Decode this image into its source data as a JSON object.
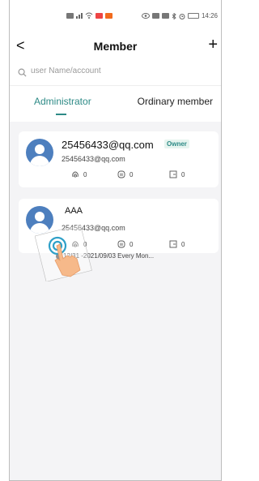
{
  "status_bar": {
    "time": "14:26",
    "left_icons": [
      "sim-icon",
      "signal-icon",
      "wifi-icon",
      "app-red-icon",
      "app-orange-icon"
    ],
    "right_icons": [
      "eye-icon",
      "nfc-icon",
      "mute-icon",
      "bluetooth-icon",
      "alarm-icon",
      "battery-icon"
    ]
  },
  "header": {
    "back_icon": "<",
    "title": "Member",
    "add_icon": "+"
  },
  "search": {
    "placeholder": "user Name/account"
  },
  "tabs": [
    {
      "label": "Administrator",
      "active": true
    },
    {
      "label": "Ordinary member",
      "active": false
    }
  ],
  "members": [
    {
      "name": "25456433@qq.com",
      "badge": "Owner",
      "account": "25456433@qq.com",
      "fingerprint_count": "0",
      "card_count": "0",
      "password_count": "0"
    },
    {
      "name": "AAA",
      "account": "25456433@qq.com",
      "fingerprint_count": "0",
      "card_count": "0",
      "password_count": "0",
      "validity": "12/31 -2021/09/03 Every Mon..."
    }
  ],
  "colors": {
    "accent": "#2d8a86",
    "avatar": "#4d7fbe",
    "background": "#f4f4f6",
    "hand_skin": "#f6b98a",
    "tap_ring": "#2fa0c8"
  },
  "overlay": {
    "gesture": "tap-hand-icon"
  }
}
